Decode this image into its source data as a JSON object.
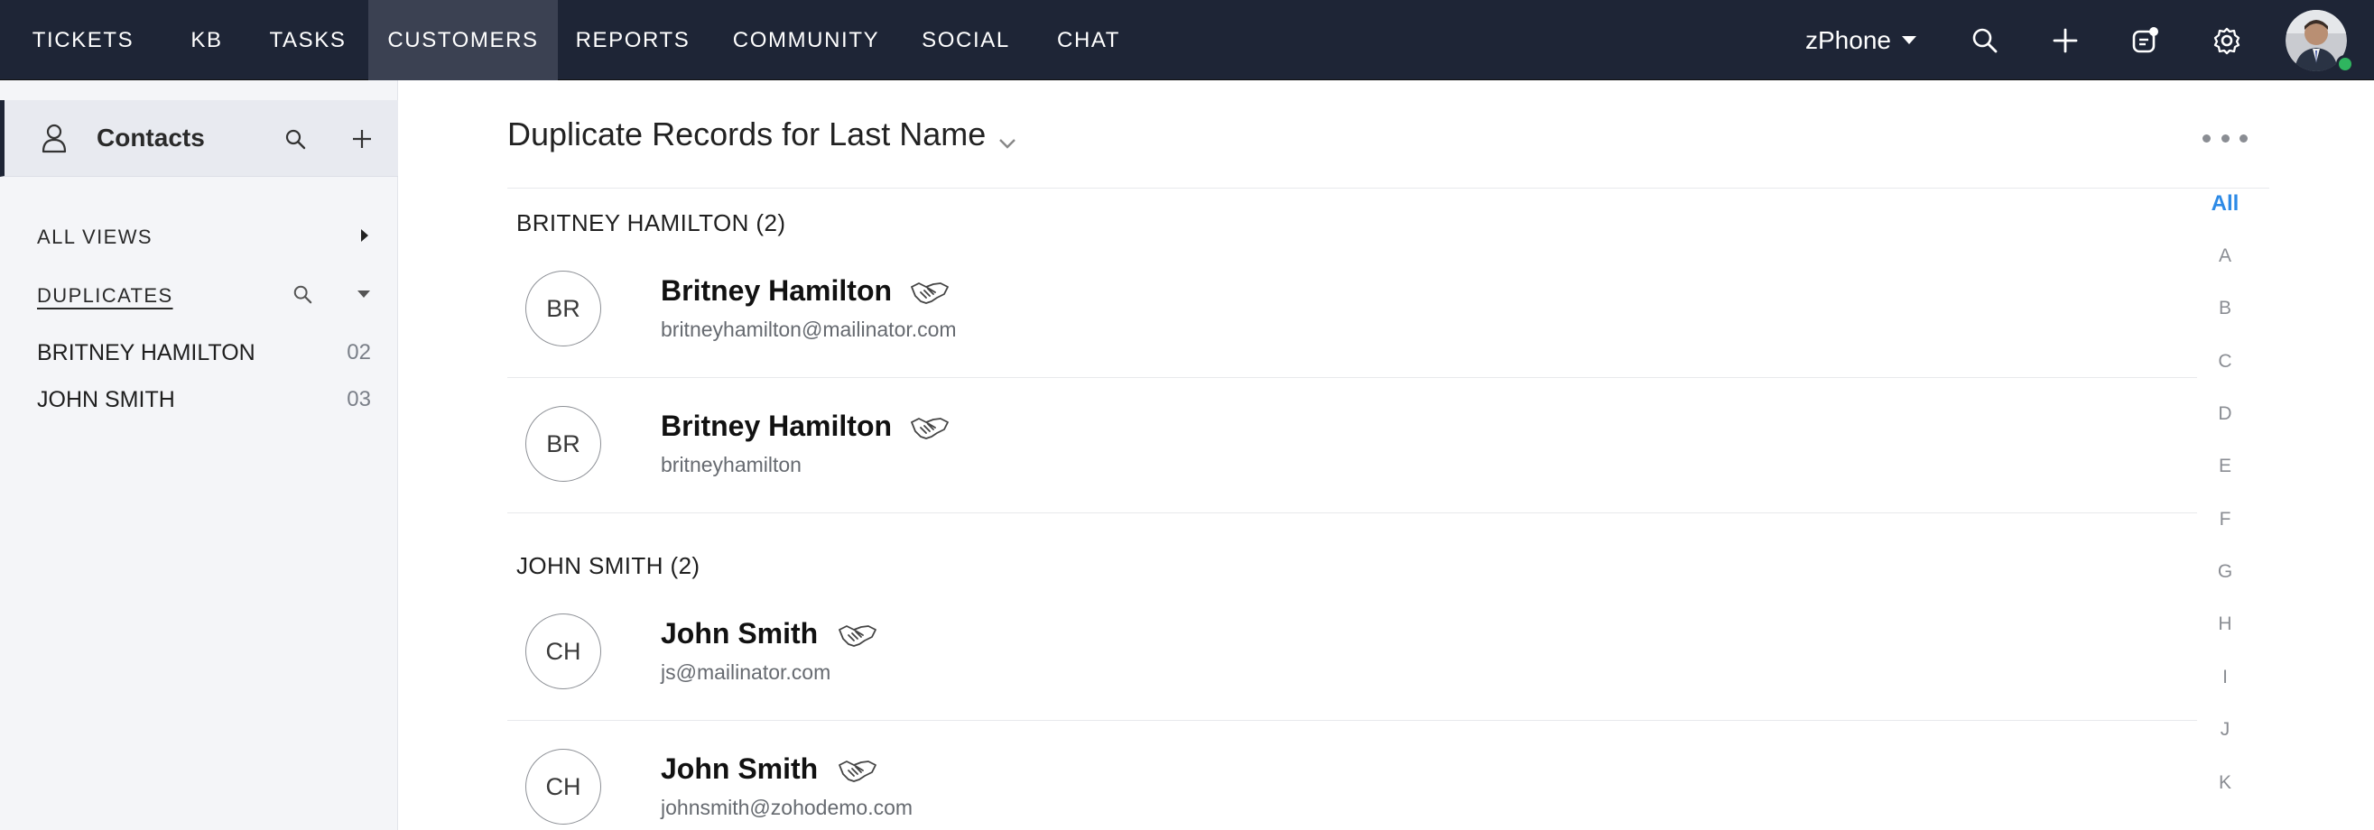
{
  "nav": {
    "items": [
      {
        "label": "TICKETS"
      },
      {
        "label": "KB"
      },
      {
        "label": "TASKS"
      },
      {
        "label": "CUSTOMERS",
        "active": true
      },
      {
        "label": "REPORTS"
      },
      {
        "label": "COMMUNITY"
      },
      {
        "label": "SOCIAL"
      },
      {
        "label": "CHAT"
      }
    ],
    "portal": "zPhone",
    "icons": [
      "search-icon",
      "add-icon",
      "notification-icon",
      "settings-icon"
    ],
    "user_status_color": "#2fb55f"
  },
  "sidebar": {
    "module": "Contacts",
    "all_views": "ALL VIEWS",
    "duplicates": "DUPLICATES",
    "items": [
      {
        "label": "BRITNEY HAMILTON",
        "count": "02"
      },
      {
        "label": "JOHN SMITH",
        "count": "03"
      }
    ]
  },
  "main": {
    "title": "Duplicate Records for Last Name",
    "groups": [
      {
        "heading": "BRITNEY HAMILTON (2)",
        "records": [
          {
            "initials": "BR",
            "name": "Britney Hamilton",
            "email": "britneyhamilton@mailinator.com"
          },
          {
            "initials": "BR",
            "name": "Britney Hamilton",
            "email": "britneyhamilton"
          }
        ]
      },
      {
        "heading": "JOHN SMITH (2)",
        "records": [
          {
            "initials": "CH",
            "name": "John Smith",
            "email": "js@mailinator.com"
          },
          {
            "initials": "CH",
            "name": "John Smith",
            "email": "johnsmith@zohodemo.com"
          }
        ]
      }
    ]
  },
  "alphabet": [
    "All",
    "A",
    "B",
    "C",
    "D",
    "E",
    "F",
    "G",
    "H",
    "I",
    "J",
    "K"
  ],
  "colors": {
    "nav_bg": "#1e2536",
    "nav_active": "#3b4152",
    "accent": "#2d8ae6"
  }
}
